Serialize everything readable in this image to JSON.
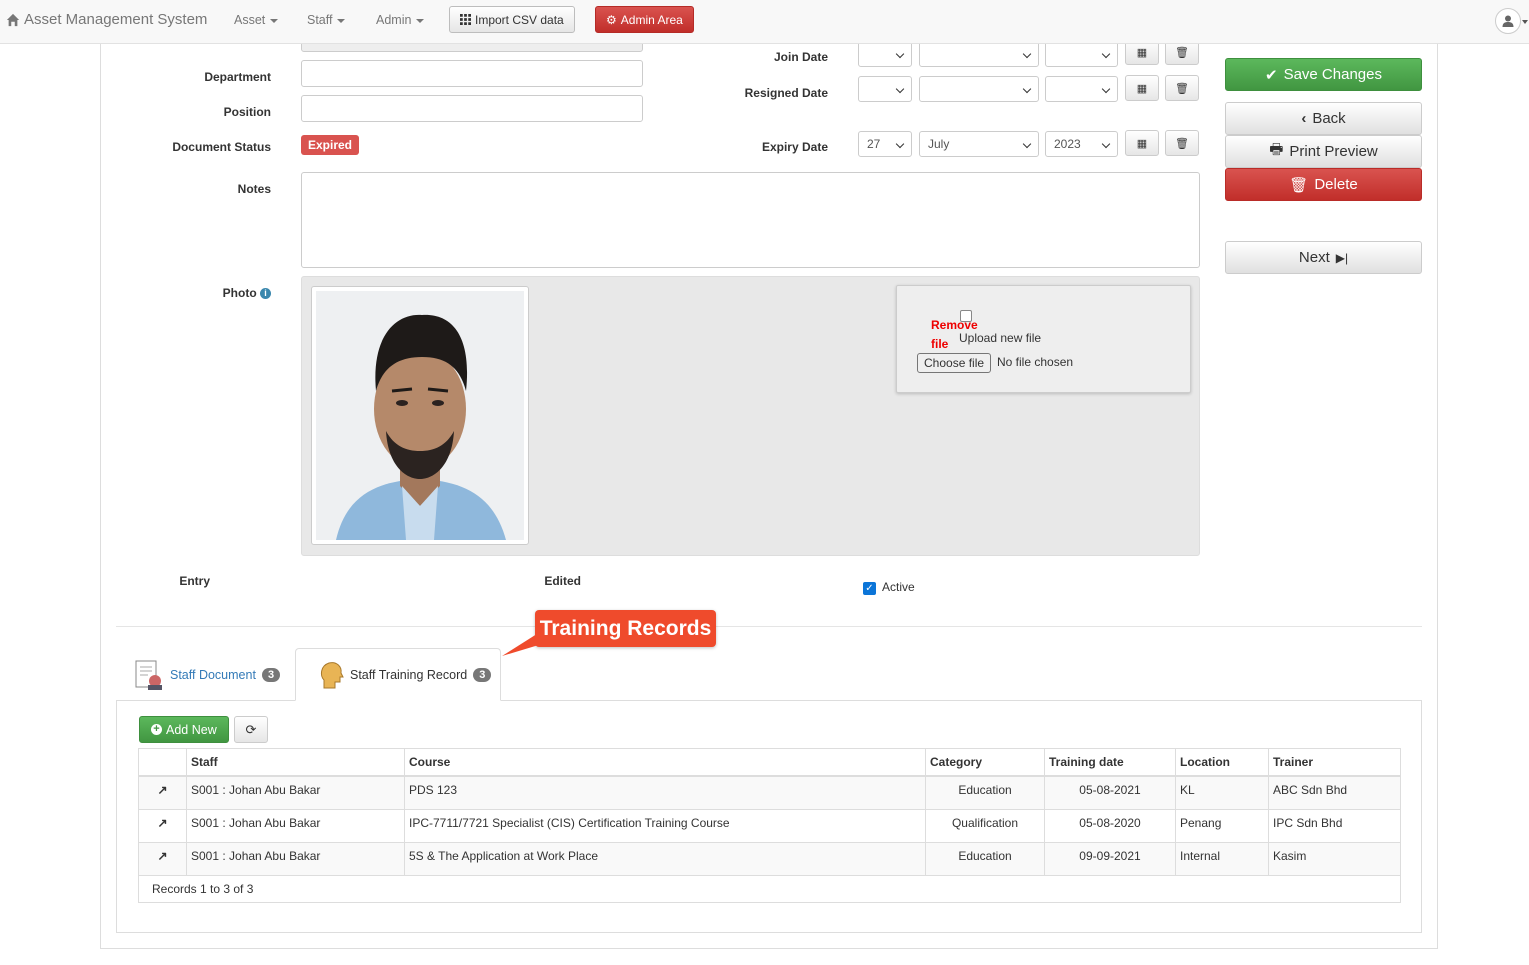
{
  "navbar": {
    "brand": "Asset Management System",
    "menus": [
      "Asset",
      "Staff",
      "Admin"
    ],
    "import_label": "Import CSV data",
    "admin_label": "Admin Area"
  },
  "form": {
    "department_label": "Department",
    "department_value": "",
    "position_label": "Position",
    "position_value": "",
    "doc_status_label": "Document Status",
    "doc_status_value": "Expired",
    "notes_label": "Notes",
    "notes_value": "",
    "photo_label": "Photo",
    "join_date_label": "Join Date",
    "resigned_date_label": "Resigned Date",
    "expiry_date_label": "Expiry Date",
    "expiry_day": "27",
    "expiry_month": "July",
    "expiry_year": "2023",
    "entry_label": "Entry",
    "edited_label": "Edited",
    "active_label": "Active",
    "remove_file_label": "Remove file",
    "upload_new_label": "Upload new file",
    "choose_file_label": "Choose file",
    "no_file_label": "No file chosen"
  },
  "side": {
    "save": "Save Changes",
    "back": "Back",
    "print": "Print Preview",
    "delete": "Delete",
    "next": "Next"
  },
  "callout": "Training Records",
  "tabs": [
    {
      "label": "Staff Document",
      "count": "3"
    },
    {
      "label": "Staff Training Record",
      "count": "3"
    }
  ],
  "toolbar": {
    "add_new": "Add New"
  },
  "table": {
    "headers": [
      "Staff",
      "Course",
      "Category",
      "Training date",
      "Location",
      "Trainer"
    ],
    "rows": [
      {
        "staff": "S001 : Johan Abu Bakar",
        "course": "PDS 123",
        "category": "Education",
        "date": "05-08-2021",
        "location": "KL",
        "trainer": "ABC Sdn Bhd"
      },
      {
        "staff": "S001 : Johan Abu Bakar",
        "course": "IPC-7711/7721 Specialist (CIS) Certification Training Course",
        "category": "Qualification",
        "date": "05-08-2020",
        "location": "Penang",
        "trainer": "IPC Sdn Bhd"
      },
      {
        "staff": "S001 : Johan Abu Bakar",
        "course": "5S & The Application at Work Place",
        "category": "Education",
        "date": "09-09-2021",
        "location": "Internal",
        "trainer": "Kasim"
      }
    ],
    "footer": "Records 1 to 3 of 3"
  },
  "colors": {
    "success": "#5cb85c",
    "danger": "#d9534f",
    "callout": "#ef4b2c"
  }
}
